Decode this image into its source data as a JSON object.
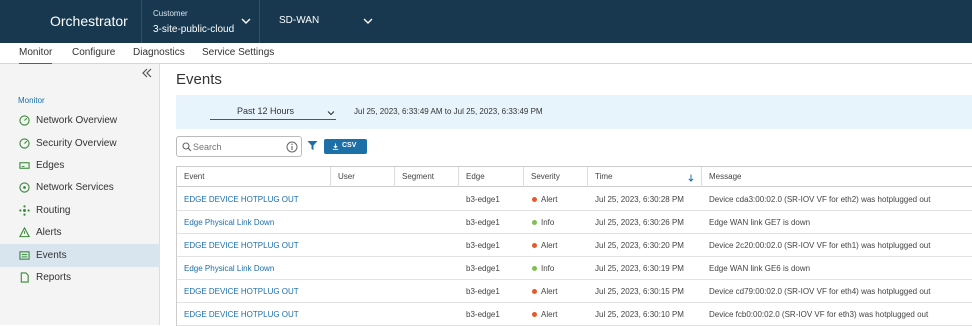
{
  "header": {
    "app_title": "Orchestrator",
    "customer_label": "Customer",
    "customer_value": "3-site-public-cloud",
    "product": "SD-WAN"
  },
  "tabs": [
    {
      "label": "Monitor",
      "active": true
    },
    {
      "label": "Configure",
      "active": false
    },
    {
      "label": "Diagnostics",
      "active": false
    },
    {
      "label": "Service Settings",
      "active": false
    }
  ],
  "sidebar": {
    "section": "Monitor",
    "items": [
      {
        "label": "Network Overview",
        "icon": "gauge-icon",
        "active": false
      },
      {
        "label": "Security Overview",
        "icon": "gauge-icon",
        "active": false
      },
      {
        "label": "Edges",
        "icon": "device-icon",
        "active": false
      },
      {
        "label": "Network Services",
        "icon": "network-services-icon",
        "active": false
      },
      {
        "label": "Routing",
        "icon": "routing-icon",
        "active": false
      },
      {
        "label": "Alerts",
        "icon": "warning-icon",
        "active": false
      },
      {
        "label": "Events",
        "icon": "events-icon",
        "active": true
      },
      {
        "label": "Reports",
        "icon": "document-icon",
        "active": false
      }
    ]
  },
  "main": {
    "title": "Events",
    "time_range": "Past 12 Hours",
    "time_range_detail": "Jul 25, 2023, 6:33:49 AM to Jul 25, 2023, 6:33:49 PM",
    "search_placeholder": "Search",
    "csv_label": "CSV"
  },
  "table": {
    "columns": [
      "Event",
      "User",
      "Segment",
      "Edge",
      "Severity",
      "Time",
      "Message"
    ],
    "sorted_column": "Time",
    "rows": [
      {
        "event": "EDGE DEVICE HOTPLUG OUT",
        "user": "",
        "segment": "",
        "edge": "b3-edge1",
        "severity": "Alert",
        "time": "Jul 25, 2023, 6:30:28 PM",
        "message": "Device cda3:00:02.0 (SR-IOV VF for eth2) was hotplugged out"
      },
      {
        "event": "Edge Physical Link Down",
        "user": "",
        "segment": "",
        "edge": "b3-edge1",
        "severity": "Info",
        "time": "Jul 25, 2023, 6:30:26 PM",
        "message": "Edge WAN link GE7 is down"
      },
      {
        "event": "EDGE DEVICE HOTPLUG OUT",
        "user": "",
        "segment": "",
        "edge": "b3-edge1",
        "severity": "Alert",
        "time": "Jul 25, 2023, 6:30:20 PM",
        "message": "Device 2c20:00:02.0 (SR-IOV VF for eth1) was hotplugged out"
      },
      {
        "event": "Edge Physical Link Down",
        "user": "",
        "segment": "",
        "edge": "b3-edge1",
        "severity": "Info",
        "time": "Jul 25, 2023, 6:30:19 PM",
        "message": "Edge WAN link GE6 is down"
      },
      {
        "event": "EDGE DEVICE HOTPLUG OUT",
        "user": "",
        "segment": "",
        "edge": "b3-edge1",
        "severity": "Alert",
        "time": "Jul 25, 2023, 6:30:15 PM",
        "message": "Device cd79:00:02.0 (SR-IOV VF for eth4) was hotplugged out"
      },
      {
        "event": "EDGE DEVICE HOTPLUG OUT",
        "user": "",
        "segment": "",
        "edge": "b3-edge1",
        "severity": "Alert",
        "time": "Jul 25, 2023, 6:30:10 PM",
        "message": "Device fcb0:00:02.0 (SR-IOV VF for eth3) was hotplugged out"
      }
    ]
  },
  "colors": {
    "header_bg": "#17384f",
    "accent": "#1b6fab",
    "alert": "#e55a2b",
    "info": "#7fbf4d",
    "active_nav": "#d9e5ee",
    "filter_panel": "#e8f4fb"
  }
}
